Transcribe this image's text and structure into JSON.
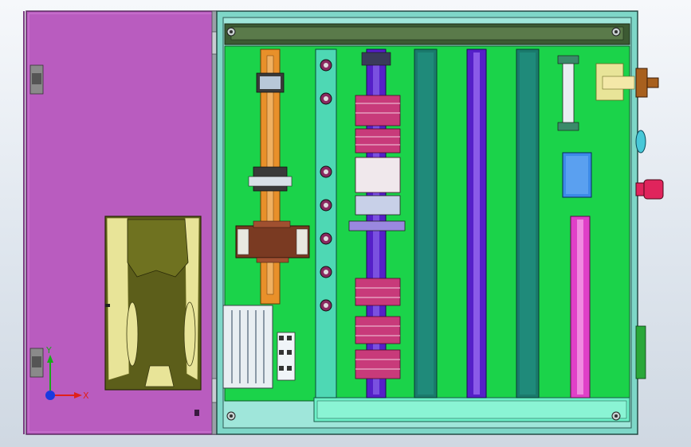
{
  "scene": {
    "colors": {
      "door": "#b95cbf",
      "door_edge": "#5a2a60",
      "cabinet_frame": "#7ed7c8",
      "backplate": "#1bd34a",
      "top_rail": "#3c5a33",
      "din_orange": "#e8902a",
      "din_cyan": "#4ed8b4",
      "din_purple": "#5520c8",
      "duct_dark": "#1a7a6c",
      "din_magenta": "#e040c8",
      "terminal_pink": "#c83a7a",
      "transformer": "#7a3a22",
      "power_supply": "#e8eef2",
      "panel_blue": "#3c8ae8",
      "holder": "#e8e498",
      "knob": "#a8601e",
      "estop": "#e0245c",
      "bottom_rail": "#6ef0c8"
    },
    "icons": [
      "hinge-icon",
      "screw-icon",
      "knob-icon",
      "emergency-stop-icon",
      "coordinate-axes-icon"
    ]
  },
  "axes": {
    "x_label": "X",
    "y_label": "Y"
  }
}
